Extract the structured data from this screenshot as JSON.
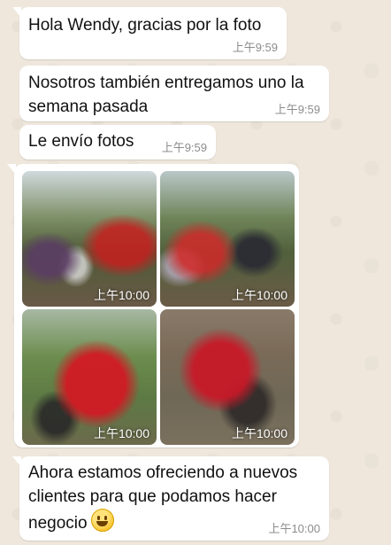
{
  "messages": [
    {
      "text": "Hola Wendy, gracias por la foto",
      "time": "上午9:59"
    },
    {
      "text": "Nosotros también entregamos uno la semana pasada",
      "time": "上午9:59"
    },
    {
      "text": "Le envío fotos",
      "time": "上午9:59"
    },
    {
      "text": "Ahora estamos ofreciendo a nuevos clientes para que podamos hacer negocio",
      "time": "上午10:00",
      "emoji": "grinning-face-emoji"
    }
  ],
  "album": {
    "photos": [
      {
        "time": "上午10:00"
      },
      {
        "time": "上午10:00"
      },
      {
        "time": "上午10:00"
      },
      {
        "time": "上午10:00"
      }
    ]
  }
}
